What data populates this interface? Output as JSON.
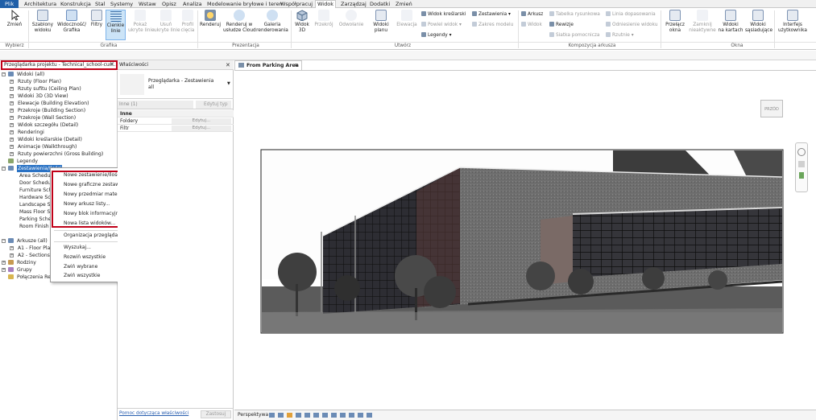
{
  "menu": {
    "tabs": [
      "Plik",
      "Architektura",
      "Konstrukcja",
      "Stal",
      "Systemy",
      "Wstaw",
      "Opisz",
      "Analiza",
      "Modelowanie bryłowe i teren",
      "Współpracuj",
      "Widok",
      "Zarządzaj",
      "Dodatki",
      "Zmień"
    ],
    "active": "Widok"
  },
  "ribbon": {
    "buttons": [
      {
        "label1": "Zmień",
        "label2": "",
        "icon": "cursor-icon",
        "disabled": false
      },
      {
        "label1": "Szablony",
        "label2": "widoku",
        "icon": "view-templates-icon",
        "disabled": false
      },
      {
        "label1": "Widoczność/",
        "label2": "Grafika",
        "icon": "visibility-graphics-icon",
        "disabled": false
      },
      {
        "label1": "Filtry",
        "label2": "",
        "icon": "filters-icon",
        "disabled": false
      },
      {
        "label1": "Cienkie",
        "label2": "linie",
        "icon": "thin-lines-icon",
        "disabled": false
      },
      {
        "label1": "Pokaż",
        "label2": "ukryte linie",
        "icon": "show-hidden-lines-icon",
        "disabled": true
      },
      {
        "label1": "Usuń",
        "label2": "ukryte linie",
        "icon": "remove-hidden-lines-icon",
        "disabled": true
      },
      {
        "label1": "Profil",
        "label2": "cięcia",
        "icon": "cut-profile-icon",
        "disabled": true
      },
      {
        "label1": "Renderuj",
        "label2": "",
        "icon": "render-icon",
        "disabled": false
      },
      {
        "label1": "Renderuj w",
        "label2": "usłudze Cloud",
        "icon": "render-cloud-icon",
        "disabled": false
      },
      {
        "label1": "Galeria",
        "label2": "renderowania",
        "icon": "render-gallery-icon",
        "disabled": false
      },
      {
        "label1": "Widok",
        "label2": "3D",
        "icon": "3d-view-icon",
        "disabled": false
      },
      {
        "label1": "Przekrój",
        "label2": "",
        "icon": "section-icon",
        "disabled": true
      },
      {
        "label1": "Odwołanie",
        "label2": "",
        "icon": "callout-icon",
        "disabled": true
      },
      {
        "label1": "Widoki",
        "label2": "planu",
        "icon": "plan-views-icon",
        "disabled": false
      },
      {
        "label1": "Elewacja",
        "label2": "",
        "icon": "elevation-icon",
        "disabled": true
      },
      {
        "label1": "Przełącz",
        "label2": "okna",
        "icon": "switch-windows-icon",
        "disabled": false
      },
      {
        "label1": "Zamknij",
        "label2": "nieaktywne",
        "icon": "close-inactive-icon",
        "disabled": true
      },
      {
        "label1": "Widoki",
        "label2": "na kartach",
        "icon": "tab-views-icon",
        "disabled": false
      },
      {
        "label1": "Widoki",
        "label2": "sąsiadujące",
        "icon": "tile-views-icon",
        "disabled": false
      },
      {
        "label1": "Interfejs",
        "label2": "użytkownika",
        "icon": "user-interface-icon",
        "disabled": false
      }
    ],
    "small": [
      {
        "label": "Widok kreślarski",
        "icon": "drafting-view-icon",
        "disabled": false
      },
      {
        "label": "Powiel widok",
        "icon": "duplicate-view-icon",
        "disabled": true
      },
      {
        "label": "Legendy",
        "icon": "legends-icon",
        "disabled": false
      },
      {
        "label": "Zestawienia",
        "icon": "schedules-icon",
        "disabled": false
      },
      {
        "label": "Zakres modelu",
        "icon": "scope-box-icon",
        "disabled": true
      },
      {
        "label": "Arkusz",
        "icon": "sheet-icon",
        "disabled": false
      },
      {
        "label": "Widok",
        "icon": "place-view-icon",
        "disabled": true
      },
      {
        "label": "Tabelka rysunkowa",
        "icon": "title-block-icon",
        "disabled": true
      },
      {
        "label": "Rewizje",
        "icon": "revisions-icon",
        "disabled": false
      },
      {
        "label": "Siatka pomocnicza",
        "icon": "guide-grid-icon",
        "disabled": true
      },
      {
        "label": "Linia dopasowania",
        "icon": "matchline-icon",
        "disabled": true
      },
      {
        "label": "Odniesienie widoku",
        "icon": "view-reference-icon",
        "disabled": true
      },
      {
        "label": "Rzutnie",
        "icon": "viewports-icon",
        "disabled": true
      }
    ],
    "groups": [
      "Wybierz",
      "Grafika",
      "Prezentacja",
      "Utwórz",
      "Kompozycja arkusza",
      "Okna"
    ]
  },
  "browser": {
    "title": "Przeglądarka projektu - Technical_school-curr...",
    "items": [
      {
        "label": "Widoki (all)",
        "level": 0,
        "toggle": "−",
        "selected": false
      },
      {
        "label": "Rzuty (Floor Plan)",
        "level": 1,
        "toggle": "+",
        "selected": false
      },
      {
        "label": "Rzuty sufitu (Ceiling Plan)",
        "level": 1,
        "toggle": "+",
        "selected": false
      },
      {
        "label": "Widoki 3D (3D View)",
        "level": 1,
        "toggle": "+",
        "selected": false
      },
      {
        "label": "Elewacje (Building Elevation)",
        "level": 1,
        "toggle": "+",
        "selected": false
      },
      {
        "label": "Przekroje (Building Section)",
        "level": 1,
        "toggle": "+",
        "selected": false
      },
      {
        "label": "Przekroje (Wall Section)",
        "level": 1,
        "toggle": "+",
        "selected": false
      },
      {
        "label": "Widok szczegółu (Detail)",
        "level": 1,
        "toggle": "+",
        "selected": false
      },
      {
        "label": "Renderingi",
        "level": 1,
        "toggle": "+",
        "selected": false
      },
      {
        "label": "Widoki kreślarskie (Detail)",
        "level": 1,
        "toggle": "+",
        "selected": false
      },
      {
        "label": "Animacje (Walkthrough)",
        "level": 1,
        "toggle": "+",
        "selected": false
      },
      {
        "label": "Rzuty powierzchni (Gross Building)",
        "level": 1,
        "toggle": "+",
        "selected": false
      },
      {
        "label": "Legendy",
        "level": 0,
        "toggle": "",
        "selected": false
      },
      {
        "label": "Zestawienia/Ilości",
        "level": 0,
        "toggle": "−",
        "selected": true
      },
      {
        "label": "Area Schedule",
        "level": 2,
        "toggle": "",
        "selected": false
      },
      {
        "label": "Door Schedule",
        "level": 2,
        "toggle": "",
        "selected": false
      },
      {
        "label": "Furniture Schedule",
        "level": 2,
        "toggle": "",
        "selected": false
      },
      {
        "label": "Hardware Schedule",
        "level": 2,
        "toggle": "",
        "selected": false
      },
      {
        "label": "Landscape Schedule",
        "level": 2,
        "toggle": "",
        "selected": false
      },
      {
        "label": "Mass Floor Schedule",
        "level": 2,
        "toggle": "",
        "selected": false
      },
      {
        "label": "Parking Schedule",
        "level": 2,
        "toggle": "",
        "selected": false
      },
      {
        "label": "Room Finish Schedule",
        "level": 2,
        "toggle": "",
        "selected": false
      },
      {
        "label": "Arkusze (all)",
        "level": 0,
        "toggle": "−",
        "selected": false
      },
      {
        "label": "A1 - Floor Plans",
        "level": 1,
        "toggle": "+",
        "selected": false
      },
      {
        "label": "A2 - Sections",
        "level": 1,
        "toggle": "+",
        "selected": false
      },
      {
        "label": "Rodziny",
        "level": 0,
        "toggle": "+",
        "selected": false
      },
      {
        "label": "Grupy",
        "level": 0,
        "toggle": "+",
        "selected": false
      },
      {
        "label": "Połączenia Revit",
        "level": 0,
        "toggle": "",
        "selected": false
      }
    ]
  },
  "context_menu": {
    "items": [
      {
        "label": "Nowe zestawienie/Ilości...",
        "sep_before": false
      },
      {
        "label": "Nowe graficzne zestawienie słupów...",
        "sep_before": false
      },
      {
        "label": "Nowy przedmiar materiałów...",
        "sep_before": false
      },
      {
        "label": "Nowy arkusz listy...",
        "sep_before": false
      },
      {
        "label": "Nowy blok informacyjny...",
        "sep_before": false
      },
      {
        "label": "Nowa lista widoków...",
        "sep_before": false
      },
      {
        "label": "Organizacja przeglądarki...",
        "sep_before": true
      },
      {
        "label": "Wyszukaj...",
        "sep_before": true
      },
      {
        "label": "Rozwiń wszystkie",
        "sep_before": false
      },
      {
        "label": "Zwiń wybrane",
        "sep_before": false
      },
      {
        "label": "Zwiń wszystkie",
        "sep_before": false
      }
    ]
  },
  "properties": {
    "title": "Właściwości",
    "type_line1": "Przeglądarka - Zestawienia",
    "type_line2": "all",
    "filter_value": "Inne (1)",
    "edit_type": "Edytuj typ",
    "section": "Inne",
    "rows": [
      {
        "name": "Foldery",
        "value": "Edytuj..."
      },
      {
        "name": "Filtr",
        "value": "Edytuj..."
      }
    ],
    "help_link": "Pomoc dotycząca właściwości",
    "apply": "Zastosuj"
  },
  "view": {
    "tab_title": "From Parking Area",
    "viewcube": "PRZÓD"
  },
  "status": {
    "mode": "Perspektywa"
  },
  "colors": {
    "accent": "#2a72c4",
    "highlight_box": "#c00018",
    "file_tab": "#1f5fa8"
  }
}
